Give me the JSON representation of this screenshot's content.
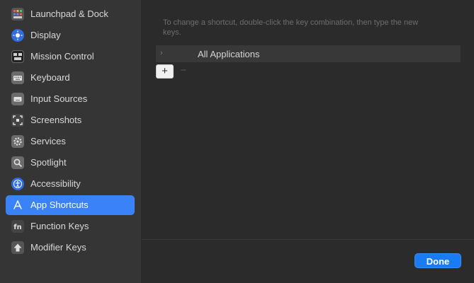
{
  "sidebar": {
    "items": [
      {
        "label": "Launchpad & Dock",
        "icon": "launchpad-icon",
        "color": "#555555"
      },
      {
        "label": "Display",
        "icon": "display-icon",
        "color": "#2f6de0"
      },
      {
        "label": "Mission Control",
        "icon": "mission-control-icon",
        "color": "#222222"
      },
      {
        "label": "Keyboard",
        "icon": "keyboard-icon",
        "color": "#6b6b6b"
      },
      {
        "label": "Input Sources",
        "icon": "input-sources-icon",
        "color": "#6b6b6b"
      },
      {
        "label": "Screenshots",
        "icon": "screenshot-icon",
        "color": "#444444"
      },
      {
        "label": "Services",
        "icon": "services-gear-icon",
        "color": "#6b6b6b"
      },
      {
        "label": "Spotlight",
        "icon": "spotlight-icon",
        "color": "#6b6b6b"
      },
      {
        "label": "Accessibility",
        "icon": "accessibility-icon",
        "color": "#2f6de0"
      },
      {
        "label": "App Shortcuts",
        "icon": "app-shortcuts-icon",
        "color": "#3a82f7",
        "selected": true
      },
      {
        "label": "Function Keys",
        "icon": "function-keys-icon",
        "color": "#444444"
      },
      {
        "label": "Modifier Keys",
        "icon": "modifier-keys-icon",
        "color": "#555555"
      }
    ]
  },
  "main": {
    "hint": "To change a shortcut, double-click the key combination, then type the new keys.",
    "app_row_label": "All Applications",
    "plus_label": "+",
    "minus_label": "−",
    "done_label": "Done"
  },
  "colors": {
    "accent": "#3a82f7",
    "done_button": "#1a7cf5"
  }
}
